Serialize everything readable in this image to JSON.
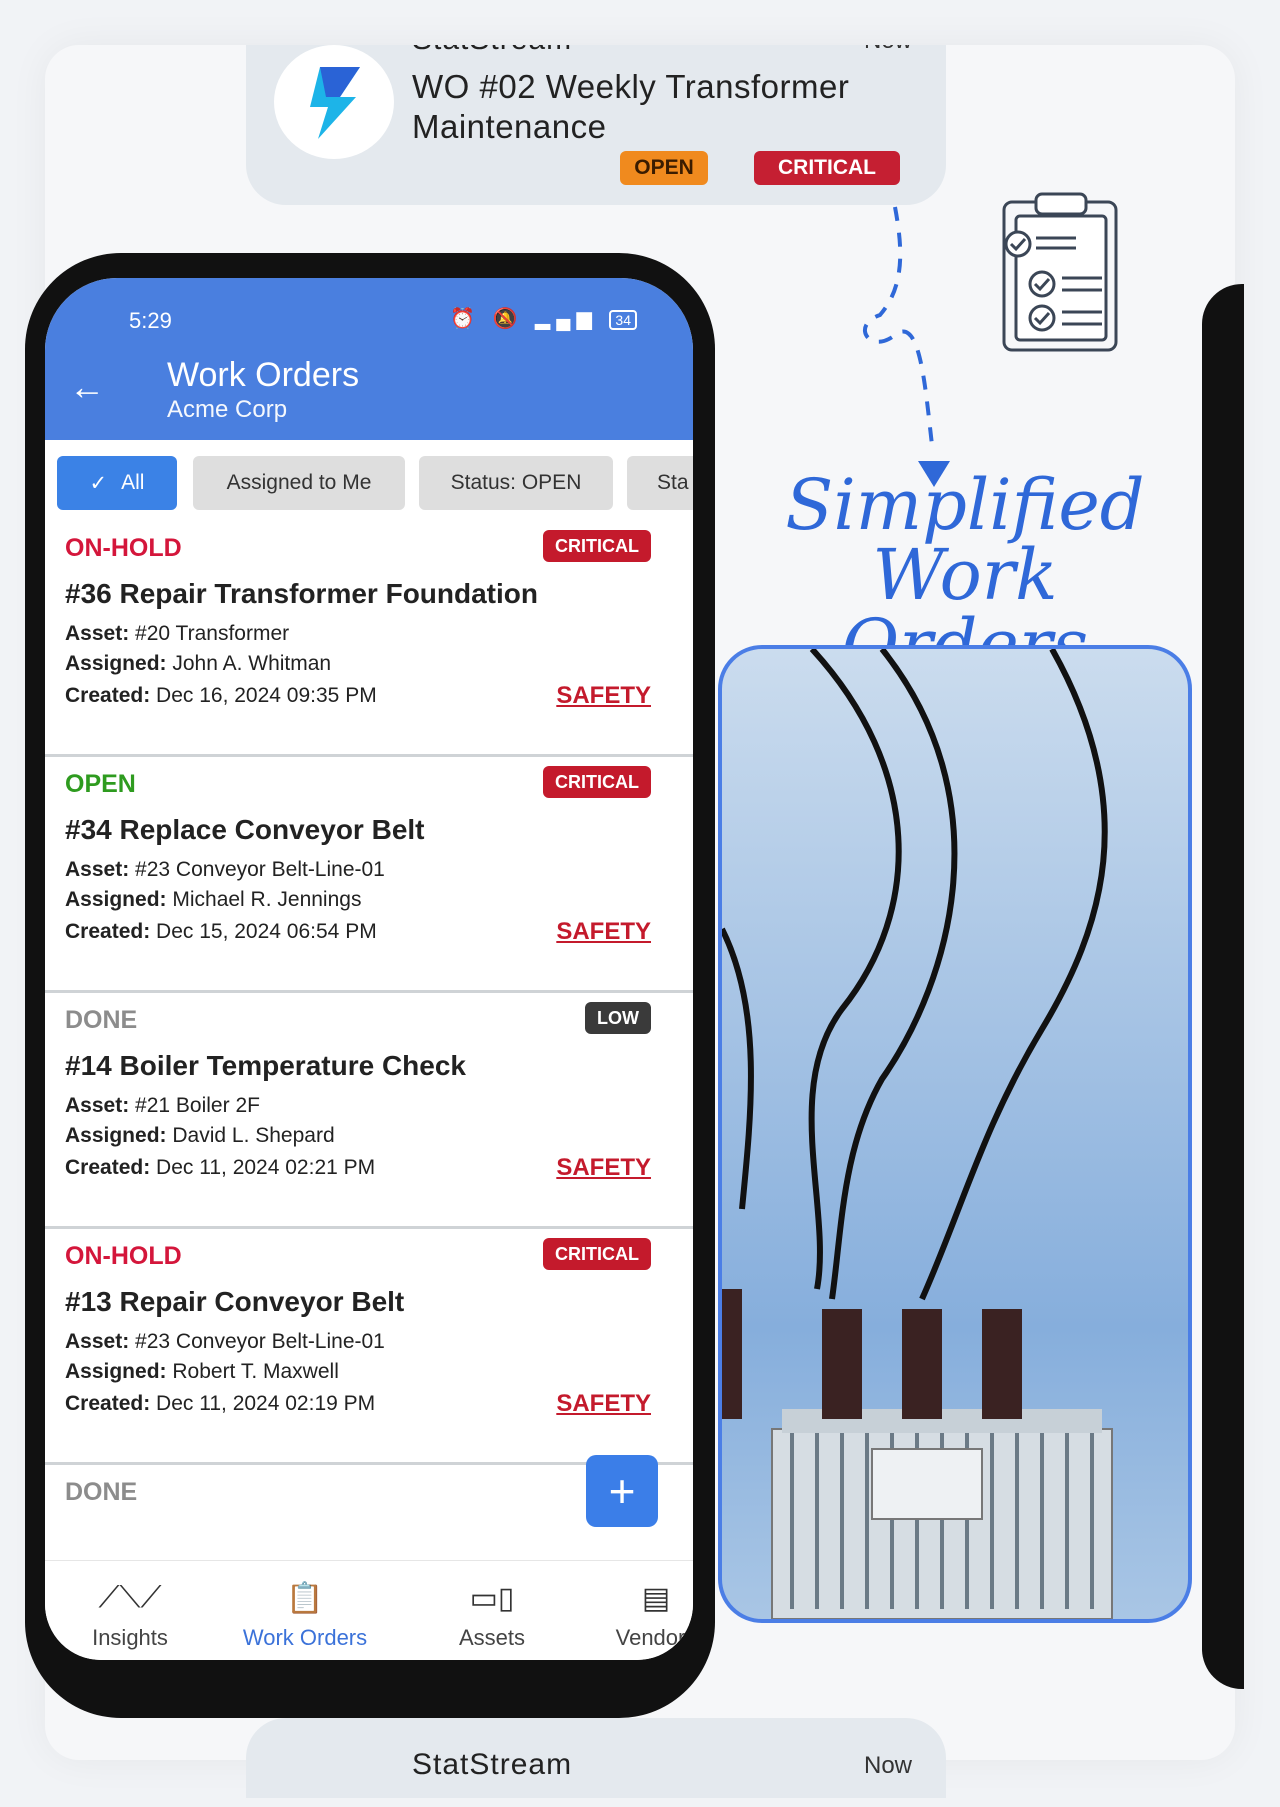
{
  "notification": {
    "app": "StatStream",
    "time": "Now",
    "title": "WO #02 Weekly Transformer Maintenance",
    "badges": [
      "OPEN",
      "CRITICAL"
    ]
  },
  "phone": {
    "status_bar": {
      "time": "5:29",
      "battery": "34"
    },
    "app_bar": {
      "title": "Work Orders",
      "subtitle": "Acme Corp"
    },
    "filters": [
      "All",
      "Assigned to Me",
      "Status: OPEN",
      "Sta"
    ],
    "work_orders": [
      {
        "status": "ON-HOLD",
        "status_color": "#d4163b",
        "priority": "CRITICAL",
        "priority_color": "#c41a2c",
        "title": "#36 Repair Transformer Foundation",
        "asset_label": "Asset:",
        "asset": "#20 Transformer",
        "assigned_label": "Assigned:",
        "assigned": "John A. Whitman",
        "created_label": "Created:",
        "created": "Dec 16, 2024 09:35 PM",
        "tag": "SAFETY"
      },
      {
        "status": "OPEN",
        "status_color": "#2e9b1f",
        "priority": "CRITICAL",
        "priority_color": "#c41a2c",
        "title": "#34 Replace Conveyor Belt",
        "asset_label": "Asset:",
        "asset": "#23 Conveyor Belt-Line-01",
        "assigned_label": "Assigned:",
        "assigned": "Michael R. Jennings",
        "created_label": "Created:",
        "created": "Dec 15, 2024 06:54 PM",
        "tag": "SAFETY"
      },
      {
        "status": "DONE",
        "status_color": "#8c8c8c",
        "priority": "LOW",
        "priority_color": "#3a3a3a",
        "title": "#14 Boiler Temperature Check",
        "asset_label": "Asset:",
        "asset": "#21 Boiler 2F",
        "assigned_label": "Assigned:",
        "assigned": "David L. Shepard",
        "created_label": "Created:",
        "created": "Dec 11, 2024 02:21 PM",
        "tag": "SAFETY"
      },
      {
        "status": "ON-HOLD",
        "status_color": "#d4163b",
        "priority": "CRITICAL",
        "priority_color": "#c41a2c",
        "title": "#13 Repair Conveyor Belt",
        "asset_label": "Asset:",
        "asset": "#23 Conveyor Belt-Line-01",
        "assigned_label": "Assigned:",
        "assigned": "Robert T. Maxwell",
        "created_label": "Created:",
        "created": "Dec 11, 2024 02:19 PM",
        "tag": "SAFETY"
      },
      {
        "status": "DONE",
        "status_color": "#8c8c8c"
      }
    ],
    "fab": "+",
    "bottom_nav": [
      {
        "label": "Insights",
        "icon": "insights-icon",
        "active": false
      },
      {
        "label": "Work Orders",
        "icon": "clipboard-icon",
        "active": true
      },
      {
        "label": "Assets",
        "icon": "devices-icon",
        "active": false
      },
      {
        "label": "Vendors",
        "icon": "store-icon",
        "active": false
      }
    ]
  },
  "headline": "Simplified Work Orders",
  "colors": {
    "appbar": "#4a7fdf",
    "accent": "#3b82e6",
    "critical": "#c41a2c",
    "open": "#f08a1e"
  }
}
